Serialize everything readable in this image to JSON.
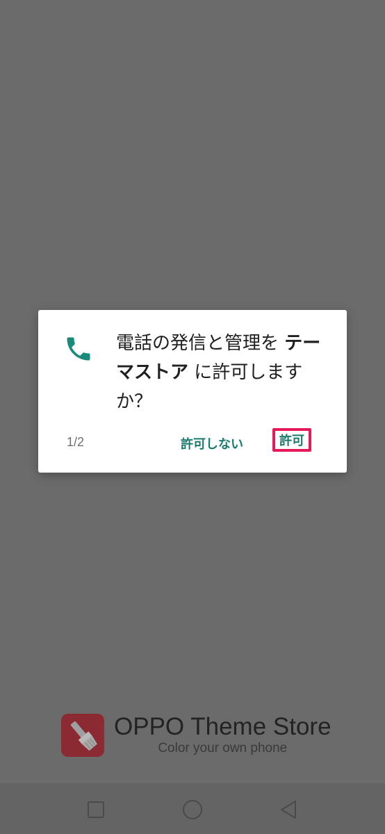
{
  "app_splash": {
    "title": "OPPO Theme Store",
    "subtitle": "Color your own phone",
    "logo_icon": "paint-brush-icon",
    "logo_color": "#8c2a33"
  },
  "dialog": {
    "icon": "phone-icon",
    "icon_color": "#1a8a7a",
    "message_prefix": "電話の発信と管理を",
    "app_name": "テーマストア",
    "message_suffix": "に許可しますか？",
    "counter": "1/2",
    "deny_label": "許可しない",
    "allow_label": "許可",
    "button_color": "#1a7a6e",
    "highlight_color": "#e6195a"
  },
  "navbar": {
    "recents_icon": "square-icon",
    "home_icon": "circle-icon",
    "back_icon": "triangle-back-icon"
  }
}
